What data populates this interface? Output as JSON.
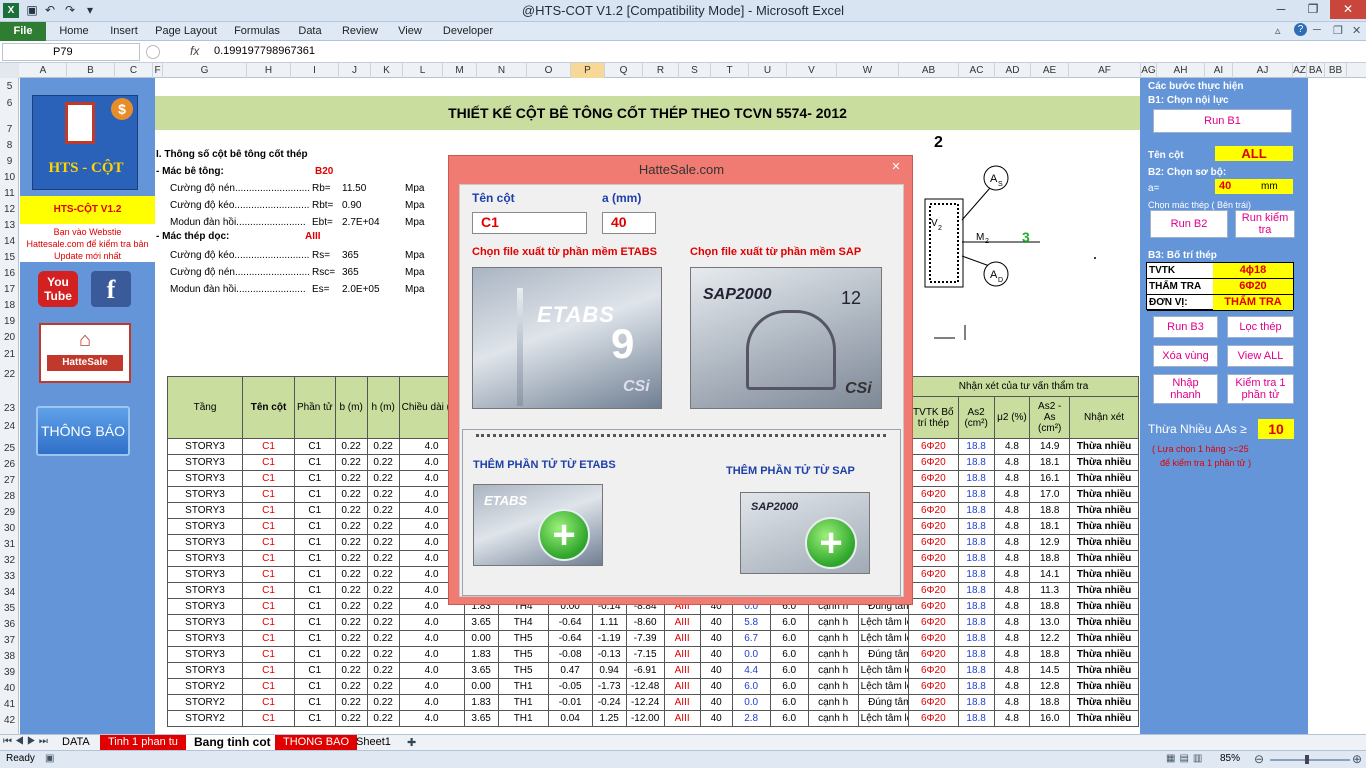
{
  "window": {
    "title": "@HTS-COT V1.2  [Compatibility Mode]  -  Microsoft Excel"
  },
  "ribbon": {
    "tabs": [
      "File",
      "Home",
      "Insert",
      "Page Layout",
      "Formulas",
      "Data",
      "Review",
      "View",
      "Developer"
    ]
  },
  "formula": {
    "namebox": "P79",
    "fx": "fx",
    "value": "0.199197798967361"
  },
  "columns": [
    "A",
    "B",
    "C",
    "F",
    "G",
    "H",
    "I",
    "J",
    "K",
    "L",
    "M",
    "N",
    "O",
    "P",
    "Q",
    "R",
    "S",
    "T",
    "U",
    "V",
    "W",
    "AB",
    "AC",
    "AD",
    "AE",
    "AF",
    "AG",
    "AH",
    "AI",
    "AJ",
    "AZ",
    "BA",
    "BB"
  ],
  "rows": [
    "5",
    "6",
    "7",
    "8",
    "9",
    "10",
    "11",
    "12",
    "13",
    "14",
    "15",
    "16",
    "17",
    "18",
    "19",
    "20",
    "21",
    "22",
    "23",
    "24",
    "25",
    "26",
    "27",
    "28",
    "29",
    "30",
    "31",
    "32",
    "33",
    "34",
    "35",
    "36",
    "37",
    "38",
    "39",
    "40",
    "41",
    "42"
  ],
  "left": {
    "logo_text": "HTS - CỘT",
    "version": "HTS-CỘT V1.2",
    "note1": "Bạn vào Webstie",
    "note2": "Hattesale.com để kiểm tra bản",
    "note3": "Update mới nhất",
    "hattesale": "HatteSale",
    "thongbao": "THÔNG BÁO"
  },
  "banner": "THIẾT KẾ CỘT BÊ TÔNG CỐT THÉP THEO TCVN 5574- 2012",
  "params": {
    "heading": "I. Thông số cột bê tông cốt thép",
    "concrete_label": "- Mác bê tông:",
    "concrete": "B20",
    "rows1": [
      [
        "Cường độ nén...........................",
        "Rb=",
        "11.50",
        "Mpa"
      ],
      [
        "Cường độ kéo...........................",
        "Rbt=",
        "0.90",
        "Mpa"
      ],
      [
        "Modun đàn hồi.........................",
        "Ebt=",
        "2.7E+04",
        "Mpa"
      ]
    ],
    "steel_label": "- Mác thép dọc:",
    "steel": "AIII",
    "rows2": [
      [
        "Cường độ kéo...........................",
        "Rs=",
        "365",
        "Mpa"
      ],
      [
        "Cường độ nén...........................",
        "Rsc=",
        "365",
        "Mpa"
      ],
      [
        "Modun đàn hồi.........................",
        "Es=",
        "2.0E+05",
        "Mpa"
      ]
    ]
  },
  "diagram": {
    "n2": "2",
    "n3": "3",
    "as": "A",
    "as_sub": "S",
    "ad": "A",
    "ad_sub": "D",
    "m2": "M",
    "m2_sub": "2",
    "v2": "V",
    "v2_sub": "2"
  },
  "right": {
    "steps": "Các bước thực hiện",
    "b1": "B1: Chọn nội lực",
    "run_b1": "Run  B1",
    "ten_cot": "Tên cột",
    "ten_cot_val": "ALL",
    "b2": "B2: Chọn sơ bộ:",
    "a_lbl": "a=",
    "a_val": "40",
    "mm": "mm",
    "chon_mac": "Chọn mác thép ( Bên trái)",
    "run_b2": "Run  B2",
    "run_kiem": "Run  kiểm tra",
    "b3": "B3: Bố trí thép",
    "tv_rows": [
      [
        "TVTK",
        "4ϕ18"
      ],
      [
        "THẨM TRA",
        "6Φ20"
      ],
      [
        "ĐƠN VỊ:",
        "THẨM TRA"
      ]
    ],
    "run_b3": "Run  B3",
    "loc_thep": "Lọc thép",
    "xoa_vung": "Xóa vùng",
    "view_all": "View ALL",
    "nhap_nhanh": "Nhập nhanh",
    "kiem_tra": "Kiểm tra 1 phần tử",
    "thua": "Thừa Nhiều  ΔAs  ≥",
    "thua_val": "10",
    "hint1": "( Lựa chọn 1 hàng >=25",
    "hint2": "để kiểm tra 1 phần tử )"
  },
  "table": {
    "headers_left": [
      "Tầng",
      "Tên cột",
      "Phần tử",
      "b (m)",
      "h (m)",
      "Chiều dài (m)"
    ],
    "header_right_group": "Nhận xét của tư vấn thẩm tra",
    "headers_right": [
      "TVTK Bố trí thép",
      "As2 (cm²)",
      "μ2 (%)",
      "As2 - As (cm²)",
      "Nhận xét"
    ],
    "rows_left": [
      [
        "STORY3",
        "C1",
        "C1",
        "0.22",
        "0.22",
        "4.0"
      ],
      [
        "STORY3",
        "C1",
        "C1",
        "0.22",
        "0.22",
        "4.0"
      ],
      [
        "STORY3",
        "C1",
        "C1",
        "0.22",
        "0.22",
        "4.0"
      ],
      [
        "STORY3",
        "C1",
        "C1",
        "0.22",
        "0.22",
        "4.0"
      ],
      [
        "STORY3",
        "C1",
        "C1",
        "0.22",
        "0.22",
        "4.0"
      ],
      [
        "STORY3",
        "C1",
        "C1",
        "0.22",
        "0.22",
        "4.0"
      ],
      [
        "STORY3",
        "C1",
        "C1",
        "0.22",
        "0.22",
        "4.0"
      ],
      [
        "STORY3",
        "C1",
        "C1",
        "0.22",
        "0.22",
        "4.0"
      ],
      [
        "STORY3",
        "C1",
        "C1",
        "0.22",
        "0.22",
        "4.0"
      ],
      [
        "STORY3",
        "C1",
        "C1",
        "0.22",
        "0.22",
        "4.0"
      ]
    ],
    "rows_full": [
      [
        "STORY3",
        "C1",
        "C1",
        "0.22",
        "0.22",
        "4.0",
        "1.83",
        "TH4",
        "0.00",
        "-0.14",
        "-8.84",
        "AIII",
        "40",
        "0.0",
        "6.0",
        "cạnh h",
        "Đúng tâm"
      ],
      [
        "STORY3",
        "C1",
        "C1",
        "0.22",
        "0.22",
        "4.0",
        "3.65",
        "TH4",
        "-0.64",
        "1.11",
        "-8.60",
        "AIII",
        "40",
        "5.8",
        "6.0",
        "cạnh h",
        "Lệch tâm lớn"
      ],
      [
        "STORY3",
        "C1",
        "C1",
        "0.22",
        "0.22",
        "4.0",
        "0.00",
        "TH5",
        "-0.64",
        "-1.19",
        "-7.39",
        "AIII",
        "40",
        "6.7",
        "6.0",
        "cạnh h",
        "Lệch tâm lớn"
      ],
      [
        "STORY3",
        "C1",
        "C1",
        "0.22",
        "0.22",
        "4.0",
        "1.83",
        "TH5",
        "-0.08",
        "-0.13",
        "-7.15",
        "AIII",
        "40",
        "0.0",
        "6.0",
        "cạnh h",
        "Đúng tâm"
      ],
      [
        "STORY3",
        "C1",
        "C1",
        "0.22",
        "0.22",
        "4.0",
        "3.65",
        "TH5",
        "0.47",
        "0.94",
        "-6.91",
        "AIII",
        "40",
        "4.4",
        "6.0",
        "cạnh h",
        "Lệch tâm lớn"
      ],
      [
        "STORY2",
        "C1",
        "C1",
        "0.22",
        "0.22",
        "4.0",
        "0.00",
        "TH1",
        "-0.05",
        "-1.73",
        "-12.48",
        "AIII",
        "40",
        "6.0",
        "6.0",
        "cạnh h",
        "Lệch tâm lớn"
      ],
      [
        "STORY2",
        "C1",
        "C1",
        "0.22",
        "0.22",
        "4.0",
        "1.83",
        "TH1",
        "-0.01",
        "-0.24",
        "-12.24",
        "AIII",
        "40",
        "0.0",
        "6.0",
        "cạnh h",
        "Đúng tâm"
      ],
      [
        "STORY2",
        "C1",
        "C1",
        "0.22",
        "0.22",
        "4.0",
        "3.65",
        "TH1",
        "0.04",
        "1.25",
        "-12.00",
        "AIII",
        "40",
        "2.8",
        "6.0",
        "cạnh h",
        "Lệch tâm lớn"
      ]
    ],
    "rows_right": [
      [
        "6Φ20",
        "18.8",
        "4.8",
        "14.9",
        "Thừa nhiều"
      ],
      [
        "6Φ20",
        "18.8",
        "4.8",
        "18.1",
        "Thừa nhiều"
      ],
      [
        "6Φ20",
        "18.8",
        "4.8",
        "16.1",
        "Thừa nhiều"
      ],
      [
        "6Φ20",
        "18.8",
        "4.8",
        "17.0",
        "Thừa nhiều"
      ],
      [
        "6Φ20",
        "18.8",
        "4.8",
        "18.8",
        "Thừa nhiều"
      ],
      [
        "6Φ20",
        "18.8",
        "4.8",
        "18.1",
        "Thừa nhiều"
      ],
      [
        "6Φ20",
        "18.8",
        "4.8",
        "12.9",
        "Thừa nhiều"
      ],
      [
        "6Φ20",
        "18.8",
        "4.8",
        "18.8",
        "Thừa nhiều"
      ],
      [
        "6Φ20",
        "18.8",
        "4.8",
        "14.1",
        "Thừa nhiều"
      ],
      [
        "6Φ20",
        "18.8",
        "4.8",
        "11.3",
        "Thừa nhiều"
      ],
      [
        "6Φ20",
        "18.8",
        "4.8",
        "18.8",
        "Thừa nhiều"
      ],
      [
        "6Φ20",
        "18.8",
        "4.8",
        "13.0",
        "Thừa nhiều"
      ],
      [
        "6Φ20",
        "18.8",
        "4.8",
        "12.2",
        "Thừa nhiều"
      ],
      [
        "6Φ20",
        "18.8",
        "4.8",
        "18.8",
        "Thừa nhiều"
      ],
      [
        "6Φ20",
        "18.8",
        "4.8",
        "14.5",
        "Thừa nhiều"
      ],
      [
        "6Φ20",
        "18.8",
        "4.8",
        "12.8",
        "Thừa nhiều"
      ],
      [
        "6Φ20",
        "18.8",
        "4.8",
        "18.8",
        "Thừa nhiều"
      ],
      [
        "6Φ20",
        "18.8",
        "4.8",
        "16.0",
        "Thừa nhiều"
      ]
    ]
  },
  "dialog": {
    "title": "HatteSale.com",
    "close": "✕",
    "ten_cot": "Tên cột",
    "a_mm": "a (mm)",
    "ten_cot_val": "C1",
    "a_val": "40",
    "etabs_title": "Chọn file xuất từ phần mềm ETABS",
    "sap_title": "Chọn file xuất từ phần mềm SAP",
    "etabs_logo": "ETABS",
    "etabs_ver": "9",
    "sap_logo": "SAP2000",
    "sap_ver": "12",
    "csi": "CSi",
    "add_etabs": "THÊM PHẦN TỬ TỪ ETABS",
    "add_sap": "THÊM PHẦN TỬ TỪ SAP",
    "plus": "+"
  },
  "sheets": [
    "DATA",
    "Tinh 1 phan tu",
    "Bang tinh cot",
    "THONG BAO",
    "Sheet1"
  ],
  "status": {
    "ready": "Ready",
    "zoom": "85%"
  }
}
